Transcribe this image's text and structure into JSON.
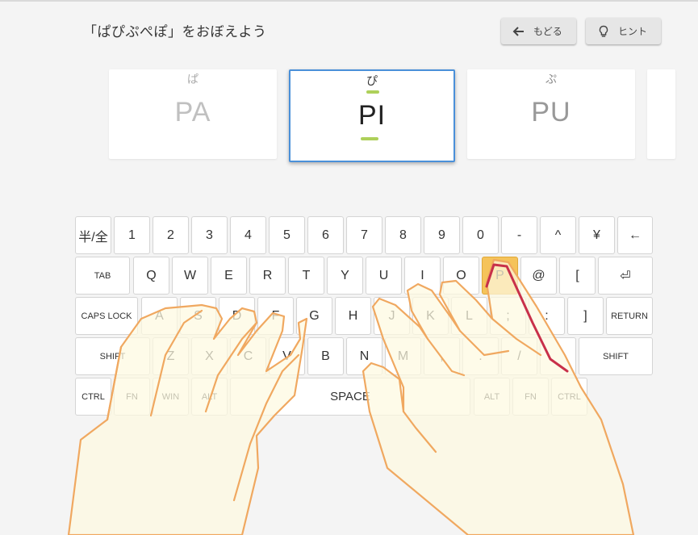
{
  "title": "「ぱぴぷぺぽ」をおぼえよう",
  "buttons": {
    "back_label": "もどる",
    "hint_label": "ヒント"
  },
  "cards": [
    {
      "kana": "ぱ",
      "roma": "PA"
    },
    {
      "kana": "ぴ",
      "roma": "PI"
    },
    {
      "kana": "ぷ",
      "roma": "PU"
    }
  ],
  "icons": {
    "back": "arrow-left-icon",
    "hint": "lightbulb-icon"
  },
  "colors": {
    "highlight_key": "#f5c35a",
    "active_card_border": "#4a90d9",
    "progress_bar": "#aed05a",
    "finger_path": "#c8304a",
    "hand_outline": "#f0a860"
  },
  "keyboard": {
    "rows": [
      [
        "半/全",
        "1",
        "2",
        "3",
        "4",
        "5",
        "6",
        "7",
        "8",
        "9",
        "0",
        "-",
        "^",
        "¥",
        "←"
      ],
      [
        "TAB",
        "Q",
        "W",
        "E",
        "R",
        "T",
        "Y",
        "U",
        "I",
        "O",
        "P",
        "@",
        "[",
        "⏎"
      ],
      [
        "CAPS LOCK",
        "A",
        "S",
        "D",
        "F",
        "G",
        "H",
        "J",
        "K",
        "L",
        ";",
        ":",
        "]",
        "RETURN"
      ],
      [
        "SHIFT",
        "Z",
        "X",
        "C",
        "V",
        "B",
        "N",
        "M",
        ",",
        ".",
        "/",
        "",
        "SHIFT"
      ],
      [
        "CTRL",
        "FN",
        "WIN",
        "ALT",
        "SPACE",
        "ALT",
        "FN",
        "CTRL"
      ]
    ],
    "highlighted_key": "P"
  }
}
